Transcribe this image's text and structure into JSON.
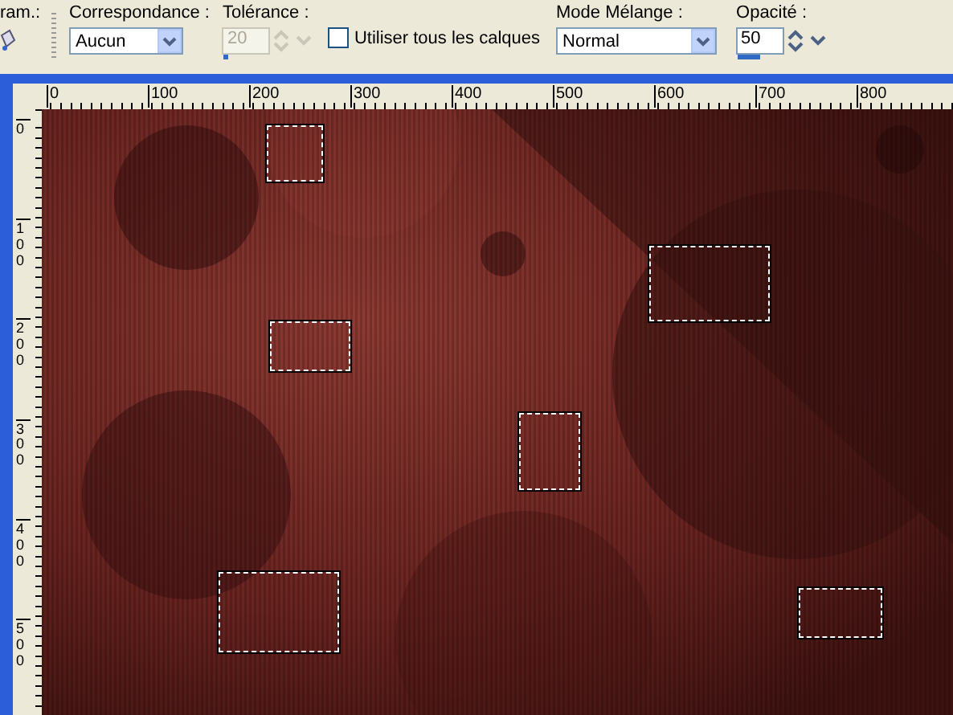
{
  "toolbar": {
    "cut_label": "ram.:",
    "matching": {
      "label": "Correspondance :",
      "value": "Aucun"
    },
    "tolerance": {
      "label": "Tolérance :",
      "value": "20",
      "disabled": true,
      "level": 0.1
    },
    "all_layers": {
      "label": "Utiliser tous les calques",
      "checked": false
    },
    "blend_mode": {
      "label": "Mode Mélange :",
      "value": "Normal"
    },
    "opacity": {
      "label": "Opacité :",
      "value": "50",
      "level": 0.5
    }
  },
  "rulers": {
    "horizontal": [
      "0",
      "100",
      "200",
      "300",
      "400",
      "500",
      "600",
      "700",
      "800"
    ],
    "vertical": [
      "0",
      "100",
      "200",
      "300",
      "400",
      "500"
    ]
  }
}
